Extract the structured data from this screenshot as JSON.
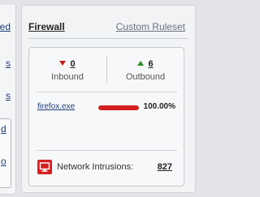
{
  "left_panel": {
    "links": [
      "ed",
      "s",
      "s",
      "ed"
    ],
    "box_links": [
      "d",
      "o"
    ]
  },
  "firewall": {
    "title": "Firewall",
    "custom_ruleset_link": "Custom Ruleset",
    "inbound": {
      "count": "0",
      "label": "Inbound"
    },
    "outbound": {
      "count": "6",
      "label": "Outbound"
    },
    "top_app": {
      "name": "firefox.exe",
      "percent_text": "100.00%",
      "percent": 100
    },
    "intrusions": {
      "label": "Network Intrusions:",
      "count": "827"
    }
  },
  "colors": {
    "inbound_arrow": "#c21a1a",
    "outbound_arrow": "#2e8b2e",
    "bar_fill": "#d42020",
    "alert_icon": "#d42020"
  }
}
